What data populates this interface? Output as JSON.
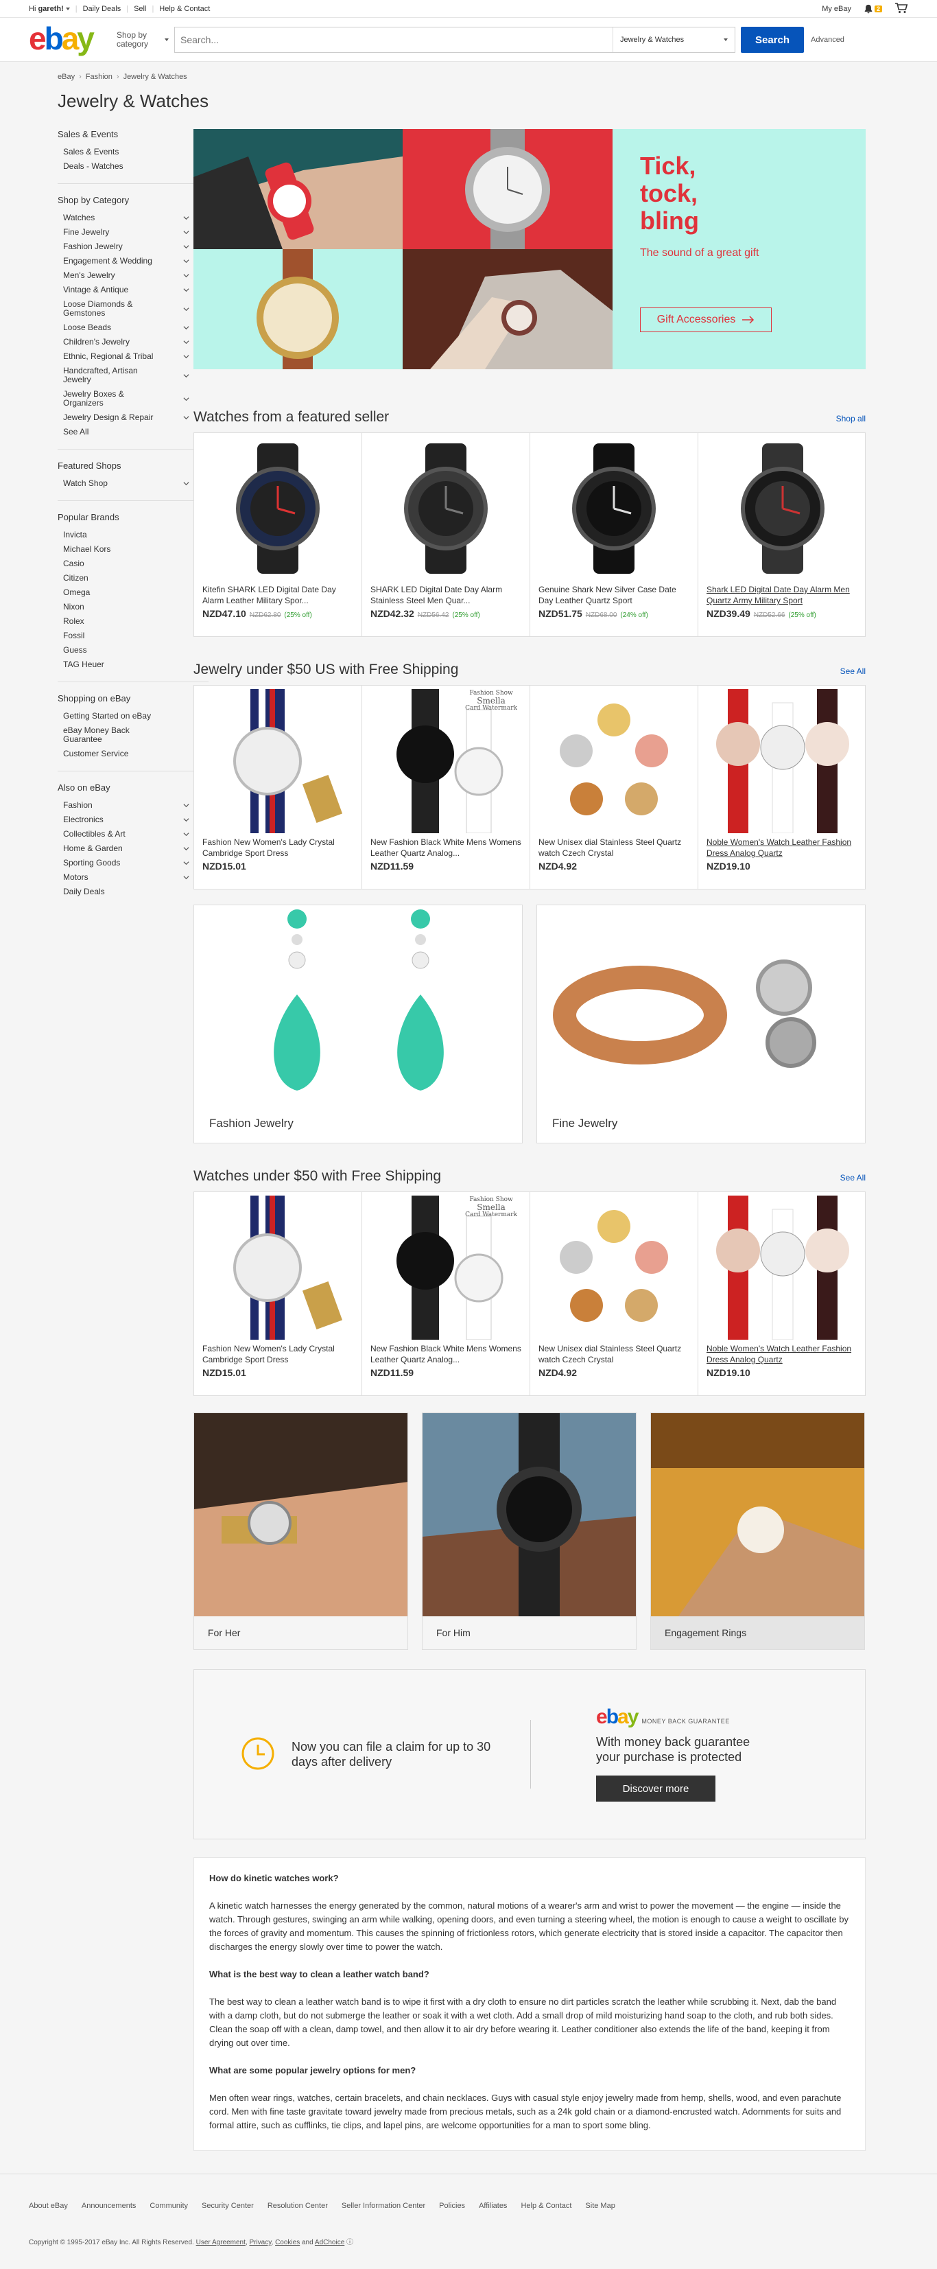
{
  "topbar": {
    "greeting_prefix": "Hi ",
    "greeting_name": "gareth!",
    "links": [
      "Daily Deals",
      "Sell",
      "Help & Contact"
    ],
    "my_ebay": "My eBay",
    "notification_count": "2"
  },
  "header": {
    "logo": {
      "e": "e",
      "b": "b",
      "a": "a",
      "y": "y"
    },
    "shop_by_category": "Shop by category",
    "search_placeholder": "Search...",
    "search_category": "Jewelry & Watches",
    "search_button": "Search",
    "advanced": "Advanced"
  },
  "breadcrumb": [
    "eBay",
    "Fashion",
    "Jewelry & Watches"
  ],
  "page_title": "Jewelry & Watches",
  "sidebar": {
    "sales_events": {
      "title": "Sales & Events",
      "items": [
        "Sales & Events",
        "Deals - Watches"
      ]
    },
    "shop_by_category": {
      "title": "Shop by Category",
      "items": [
        "Watches",
        "Fine Jewelry",
        "Fashion Jewelry",
        "Engagement & Wedding",
        "Men's Jewelry",
        "Vintage & Antique",
        "Loose Diamonds & Gemstones",
        "Loose Beads",
        "Children's Jewelry",
        "Ethnic, Regional & Tribal",
        "Handcrafted, Artisan Jewelry",
        "Jewelry Boxes & Organizers",
        "Jewelry Design & Repair",
        "See All"
      ]
    },
    "featured_shops": {
      "title": "Featured Shops",
      "items": [
        "Watch Shop"
      ]
    },
    "popular_brands": {
      "title": "Popular Brands",
      "items": [
        "Invicta",
        "Michael Kors",
        "Casio",
        "Citizen",
        "Omega",
        "Nixon",
        "Rolex",
        "Fossil",
        "Guess",
        "TAG Heuer"
      ]
    },
    "shopping_on_ebay": {
      "title": "Shopping on eBay",
      "items": [
        "Getting Started on eBay",
        "eBay Money Back Guarantee",
        "Customer Service"
      ]
    },
    "also_on_ebay": {
      "title": "Also on eBay",
      "items": [
        "Fashion",
        "Electronics",
        "Collectibles & Art",
        "Home & Garden",
        "Sporting Goods",
        "Motors",
        "Daily Deals"
      ]
    }
  },
  "hero": {
    "headline_1": "Tick,",
    "headline_2": "tock,",
    "headline_3": "bling",
    "subtitle": "The sound of a great gift",
    "button": "Gift Accessories"
  },
  "featured_seller": {
    "title": "Watches from a featured seller",
    "link": "Shop all",
    "items": [
      {
        "title": "Kitefin SHARK LED Digital Date Day Alarm Leather Military Spor...",
        "price": "NZD47.10",
        "was": "NZD62.80",
        "off": "(25% off)"
      },
      {
        "title": "SHARK LED Digital Date Day Alarm Stainless Steel Men Quar...",
        "price": "NZD42.32",
        "was": "NZD56.42",
        "off": "(25% off)"
      },
      {
        "title": "Genuine Shark New Silver Case Date Day Leather Quartz Sport",
        "price": "NZD51.75",
        "was": "NZD68.00",
        "off": "(24% off)"
      },
      {
        "title": "Shark LED Digital Date Day Alarm Men Quartz Army Military Sport",
        "price": "NZD39.49",
        "was": "NZD52.66",
        "off": "(25% off)"
      }
    ]
  },
  "jewelry_under_50": {
    "title": "Jewelry under $50 US with Free Shipping",
    "link": "See All",
    "items": [
      {
        "title": "Fashion New Women's Lady Crystal Cambridge Sport Dress",
        "price": "NZD15.01"
      },
      {
        "title": "New Fashion Black White Mens Womens Leather Quartz Analog...",
        "price": "NZD11.59"
      },
      {
        "title": "New Unisex dial Stainless Steel Quartz watch Czech Crystal",
        "price": "NZD4.92"
      },
      {
        "title": "Noble Women's Watch Leather Fashion Dress Analog Quartz",
        "price": "NZD19.10"
      }
    ]
  },
  "category_tiles": [
    "Fashion Jewelry",
    "Fine Jewelry"
  ],
  "watches_under_50": {
    "title": "Watches under $50 with Free Shipping",
    "link": "See All",
    "items": [
      {
        "title": "Fashion New Women's Lady Crystal Cambridge Sport Dress",
        "price": "NZD15.01"
      },
      {
        "title": "New Fashion Black White Mens Womens Leather Quartz Analog...",
        "price": "NZD11.59"
      },
      {
        "title": "New Unisex dial Stainless Steel Quartz watch Czech Crystal",
        "price": "NZD4.92"
      },
      {
        "title": "Noble Women's Watch Leather Fashion Dress Analog Quartz",
        "price": "NZD19.10"
      }
    ]
  },
  "watermark": {
    "line1": "Fashion Show",
    "line2": "Smella",
    "line3": "Card Watermark"
  },
  "gender_tiles": [
    "For Her",
    "For Him",
    "Engagement Rings"
  ],
  "guarantee": {
    "claim": "Now you can file a claim for up to 30 days after delivery",
    "tagline": "MONEY BACK GUARANTEE",
    "text": "With money back guarantee your purchase is protected",
    "button": "Discover more"
  },
  "faq": [
    {
      "q": "How do kinetic watches work?",
      "a": "A kinetic watch harnesses the energy generated by the common, natural motions of a wearer's arm and wrist to power the movement — the engine — inside the watch. Through gestures, swinging an arm while walking, opening doors, and even turning a steering wheel, the motion is enough to cause a weight to oscillate by the forces of gravity and momentum. This causes the spinning of frictionless rotors, which generate electricity that is stored inside a capacitor. The capacitor then discharges the energy slowly over time to power the watch."
    },
    {
      "q": "What is the best way to clean a leather watch band?",
      "a": "The best way to clean a leather watch band is to wipe it first with a dry cloth to ensure no dirt particles scratch the leather while scrubbing it. Next, dab the band with a damp cloth, but do not submerge the leather or soak it with a wet cloth. Add a small drop of mild moisturizing hand soap to the cloth, and rub both sides. Clean the soap off with a clean, damp towel, and then allow it to air dry before wearing it. Leather conditioner also extends the life of the band, keeping it from drying out over time."
    },
    {
      "q": "What are some popular jewelry options for men?",
      "a": "Men often wear rings, watches, certain bracelets, and chain necklaces. Guys with casual style enjoy jewelry made from hemp, shells, wood, and even parachute cord. Men with fine taste gravitate toward jewelry made from precious metals, such as a 24k gold chain or a diamond-encrusted watch. Adornments for suits and formal attire, such as cufflinks, tie clips, and lapel pins, are welcome opportunities for a man to sport some bling."
    }
  ],
  "footer": {
    "links": [
      "About eBay",
      "Announcements",
      "Community",
      "Security Center",
      "Resolution Center",
      "Seller Information Center",
      "Policies",
      "Affiliates",
      "Help & Contact",
      "Site Map"
    ],
    "copyright": "Copyright © 1995-2017 eBay Inc. All Rights Reserved.",
    "legal_links": [
      "User Agreement",
      "Privacy",
      "Cookies",
      "AdChoice"
    ],
    "and": "and"
  }
}
